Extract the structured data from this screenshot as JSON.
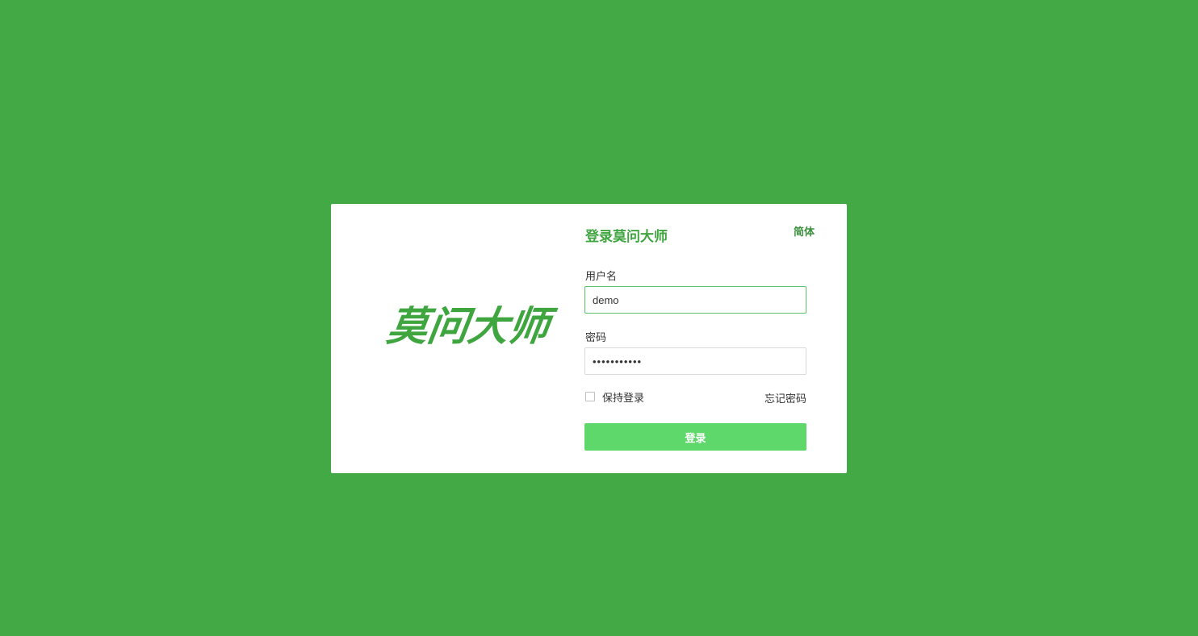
{
  "brand": {
    "logo_text": "莫问大师"
  },
  "login_form": {
    "title": "登录莫问大师",
    "language_switch": "简体",
    "username_label": "用户名",
    "username_value": "demo",
    "password_label": "密码",
    "password_value": "•••••••••••",
    "remember_label": "保持登录",
    "remember_checked": false,
    "forgot_label": "忘记密码",
    "submit_label": "登录"
  },
  "colors": {
    "background": "#43a944",
    "brand_green": "#3ea53f",
    "button_green": "#5ed86b",
    "input_focus_border": "#5cc26a"
  }
}
